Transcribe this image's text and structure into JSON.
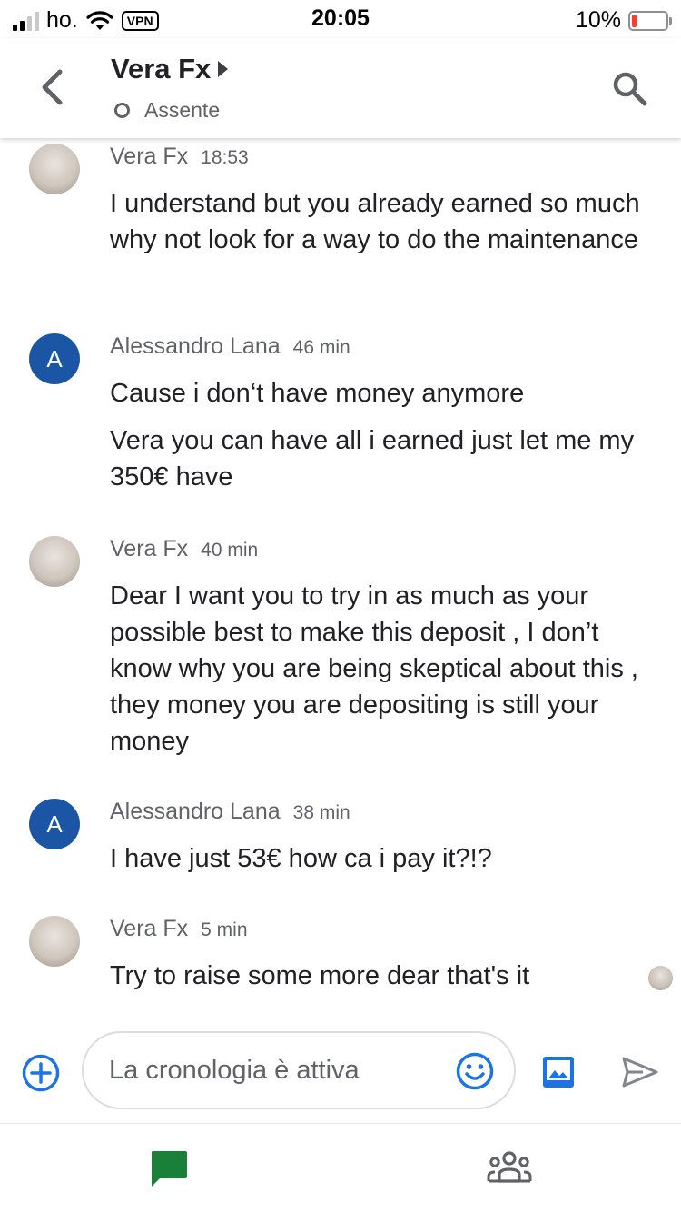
{
  "status_bar": {
    "carrier": "ho.",
    "vpn": "VPN",
    "time": "20:05",
    "battery_pct": "10%",
    "battery_level": 0.1
  },
  "header": {
    "title": "Vera Fx",
    "presence": "Assente"
  },
  "messages": [
    {
      "sender": "Vera Fx",
      "time": "18:53",
      "avatar": "photo",
      "lines": [
        "I understand but you already earned so much why not look for a way to do the maintenance"
      ]
    },
    {
      "sender": "Alessandro Lana",
      "time": "46 min",
      "avatar": "letter",
      "initial": "A",
      "lines": [
        "Cause i don‘t have money anymore",
        "Vera you can have all i earned just let me my 350€ have"
      ]
    },
    {
      "sender": "Vera Fx",
      "time": "40 min",
      "avatar": "photo",
      "lines": [
        "Dear I want you to try in as much as your possible best to make this deposit , I don’t know why you are being skeptical about this , they money you are depositing is still your money"
      ]
    },
    {
      "sender": "Alessandro Lana",
      "time": "38 min",
      "avatar": "letter",
      "initial": "A",
      "lines": [
        "I have just 53€ how ca i pay it?!?"
      ]
    },
    {
      "sender": "Vera Fx",
      "time": "5 min",
      "avatar": "photo",
      "lines": [
        "Try to raise some more dear that's it"
      ]
    }
  ],
  "composer": {
    "placeholder": "La cronologia è attiva"
  },
  "colors": {
    "accent_blue": "#1a73e8",
    "avatar_blue": "#1a56a4",
    "chat_green": "#188038",
    "battery_red": "#ff3b30"
  },
  "icons": {
    "back": "chevron-left-icon",
    "search": "search-icon",
    "add": "add-circle-icon",
    "emoji": "emoji-icon",
    "image": "image-icon",
    "send": "send-icon",
    "chat": "chat-icon",
    "people": "people-icon"
  }
}
